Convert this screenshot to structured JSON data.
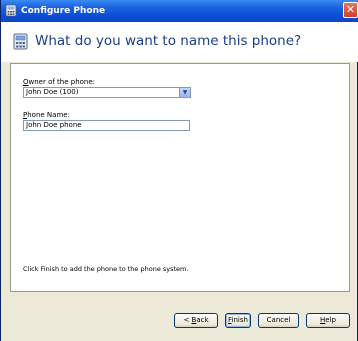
{
  "window": {
    "title": "Configure Phone",
    "close_glyph": "✕"
  },
  "header": {
    "title": "What do you want to name this phone?",
    "icon": "phone-icon"
  },
  "form": {
    "owner_label_prefix": "O",
    "owner_label_rest": "wner of the phone:",
    "owner_value": "John Doe  (100)",
    "name_label_prefix": "P",
    "name_label_rest": "hone Name:",
    "name_value": "John Doe phone"
  },
  "info_text": "Click Finish to add the phone to the phone system.",
  "buttons": {
    "back_prefix": "< ",
    "back_accel": "B",
    "back_rest": "ack",
    "finish_accel": "F",
    "finish_rest": "inish",
    "cancel": "Cancel",
    "help_accel": "H",
    "help_rest": "elp"
  }
}
